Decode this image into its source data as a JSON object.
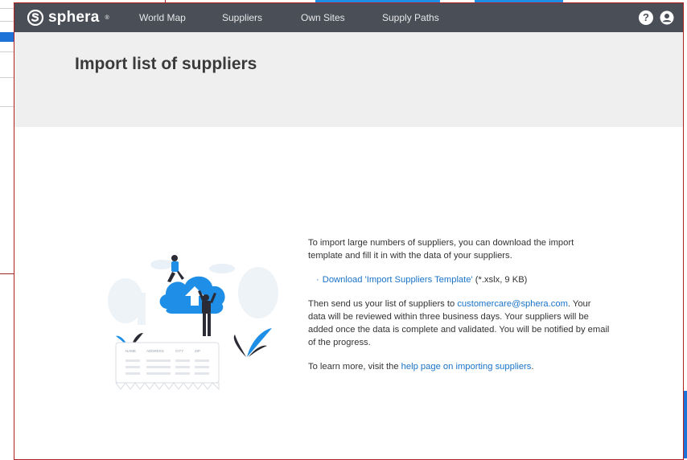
{
  "navbar": {
    "brand": "sphera",
    "brand_mark": "®",
    "items": [
      "World Map",
      "Suppliers",
      "Own Sites",
      "Supply Paths"
    ],
    "help_icon": "?",
    "user_icon": "user-circle"
  },
  "page": {
    "title": "Import list of suppliers"
  },
  "content": {
    "intro": "To import large numbers of suppliers, you can download the import template and fill it in with the data of your suppliers.",
    "download_bullet": "·",
    "download_link": "Download 'Import Suppliers Template'",
    "download_meta": " (*.xslx, 9 KB)",
    "send_prefix": "Then send us your list of suppliers to ",
    "email": "customercare@sphera.com",
    "send_suffix": ". Your data will be reviewed within three business days. Your suppliers will be added once the data is complete and validated. You will be notified by email of the progress.",
    "learn_prefix": "To learn more, visit the ",
    "help_link": "help page on importing suppliers",
    "learn_suffix": "."
  },
  "illustration": {
    "columns": [
      "NAME",
      "ADDRESS",
      "CITY",
      "ZIP"
    ]
  },
  "colors": {
    "navbar": "#4a4e57",
    "header_band": "#efeff0",
    "link": "#1a73c8",
    "accent_blue": "#1e8ee6",
    "frame_red": "#b22222"
  }
}
